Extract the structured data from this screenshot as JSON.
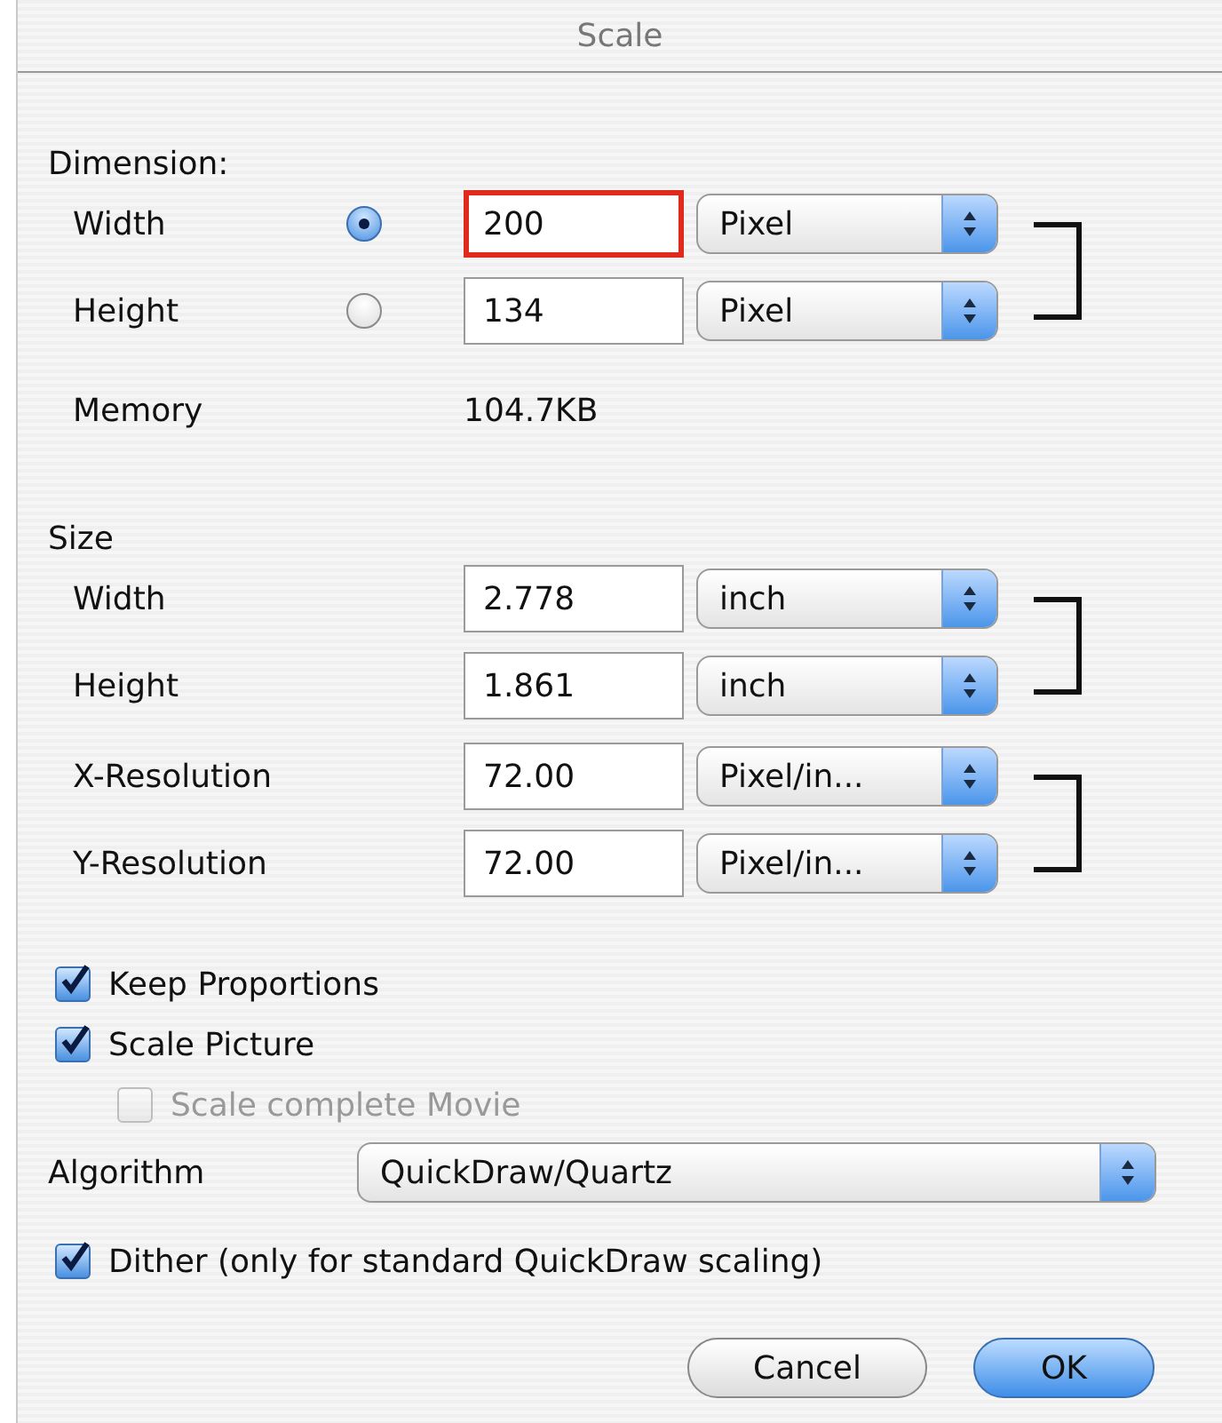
{
  "window": {
    "title": "Scale"
  },
  "dimension": {
    "label": "Dimension:",
    "groups": [
      {
        "rows": [
          {
            "label": "Width",
            "selected": true,
            "value": "200",
            "highlighted": true,
            "unit": "Pixel"
          },
          {
            "label": "Height",
            "selected": false,
            "value": "134",
            "highlighted": false,
            "unit": "Pixel"
          }
        ]
      }
    ],
    "memory": {
      "label": "Memory",
      "value": "104.7KB"
    }
  },
  "size": {
    "label": "Size",
    "groups": [
      {
        "rows": [
          {
            "label": "Width",
            "value": "2.778",
            "highlighted": false,
            "unit": "inch"
          },
          {
            "label": "Height",
            "value": "1.861",
            "highlighted": false,
            "unit": "inch"
          }
        ]
      },
      {
        "rows": [
          {
            "label": "X-Resolution",
            "value": "72.00",
            "highlighted": false,
            "unit": "Pixel/in..."
          },
          {
            "label": "Y-Resolution",
            "value": "72.00",
            "highlighted": false,
            "unit": "Pixel/in..."
          }
        ]
      }
    ]
  },
  "options": [
    {
      "label": "Keep Proportions",
      "checked": true,
      "disabled": false
    },
    {
      "label": "Scale Picture",
      "checked": true,
      "disabled": false,
      "children": [
        {
          "label": "Scale complete Movie",
          "checked": false,
          "disabled": true
        }
      ]
    }
  ],
  "algorithm": {
    "label": "Algorithm",
    "value": "QuickDraw/Quartz"
  },
  "dither": {
    "label": "Dither (only for standard QuickDraw scaling)",
    "checked": true,
    "disabled": false
  },
  "buttons": [
    {
      "label": "Cancel",
      "default": false
    },
    {
      "label": "OK",
      "default": true
    }
  ]
}
